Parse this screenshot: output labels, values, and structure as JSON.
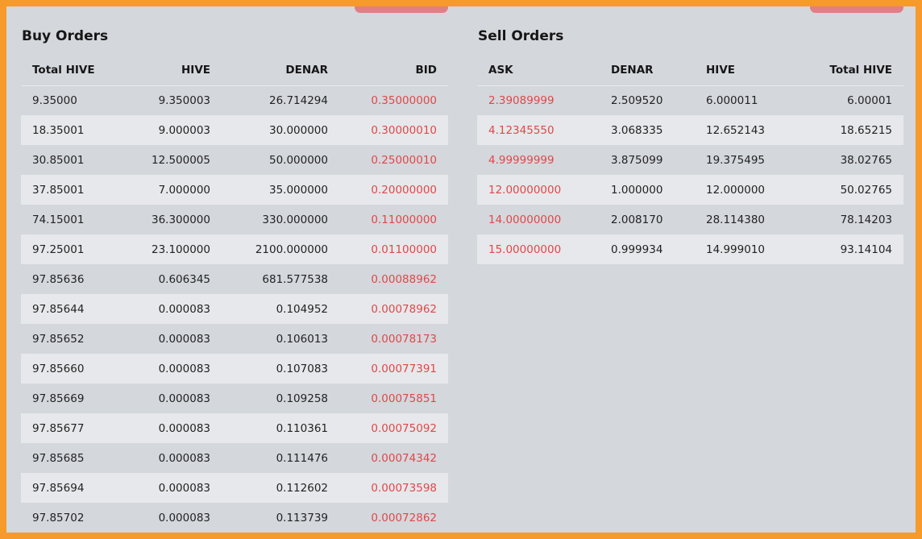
{
  "buy_orders": {
    "title": "Buy Orders",
    "columns": [
      "Total HIVE",
      "HIVE",
      "DENAR",
      "BID"
    ],
    "rows": [
      [
        "9.35000",
        "9.350003",
        "26.714294",
        "0.35000000"
      ],
      [
        "18.35001",
        "9.000003",
        "30.000000",
        "0.30000010"
      ],
      [
        "30.85001",
        "12.500005",
        "50.000000",
        "0.25000010"
      ],
      [
        "37.85001",
        "7.000000",
        "35.000000",
        "0.20000000"
      ],
      [
        "74.15001",
        "36.300000",
        "330.000000",
        "0.11000000"
      ],
      [
        "97.25001",
        "23.100000",
        "2100.000000",
        "0.01100000"
      ],
      [
        "97.85636",
        "0.606345",
        "681.577538",
        "0.00088962"
      ],
      [
        "97.85644",
        "0.000083",
        "0.104952",
        "0.00078962"
      ],
      [
        "97.85652",
        "0.000083",
        "0.106013",
        "0.00078173"
      ],
      [
        "97.85660",
        "0.000083",
        "0.107083",
        "0.00077391"
      ],
      [
        "97.85669",
        "0.000083",
        "0.109258",
        "0.00075851"
      ],
      [
        "97.85677",
        "0.000083",
        "0.110361",
        "0.00075092"
      ],
      [
        "97.85685",
        "0.000083",
        "0.111476",
        "0.00074342"
      ],
      [
        "97.85694",
        "0.000083",
        "0.112602",
        "0.00073598"
      ],
      [
        "97.85702",
        "0.000083",
        "0.113739",
        "0.00072862"
      ]
    ]
  },
  "sell_orders": {
    "title": "Sell Orders",
    "columns": [
      "ASK",
      "DENAR",
      "HIVE",
      "Total HIVE"
    ],
    "rows": [
      [
        "2.39089999",
        "2.509520",
        "6.000011",
        "6.00001"
      ],
      [
        "4.12345550",
        "3.068335",
        "12.652143",
        "18.65215"
      ],
      [
        "4.99999999",
        "3.875099",
        "19.375495",
        "38.02765"
      ],
      [
        "12.00000000",
        "1.000000",
        "12.000000",
        "50.02765"
      ],
      [
        "14.00000000",
        "2.008170",
        "28.114380",
        "78.14203"
      ],
      [
        "15.00000000",
        "0.999934",
        "14.999010",
        "93.14104"
      ]
    ]
  },
  "colors": {
    "frame_border": "#f59a2b",
    "panel_background": "#d4d7dc",
    "row_alt": "#e6e8eb",
    "price_red": "#e04848",
    "tab_stub": "#e07a80"
  }
}
